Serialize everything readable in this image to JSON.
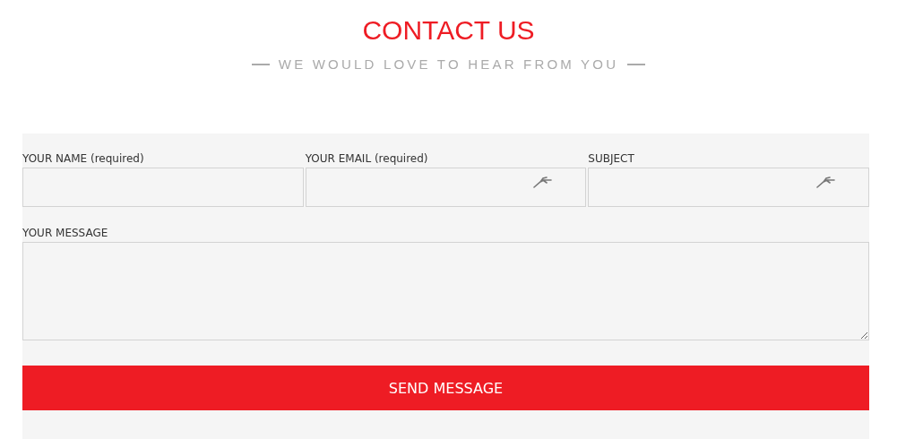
{
  "header": {
    "title": "CONTACT US",
    "subtitle": "WE WOULD LOVE TO HEAR FROM YOU"
  },
  "fields": [
    {
      "label": "YOUR NAME (required)",
      "kind": "text",
      "autofill_icon": false
    },
    {
      "label": "YOUR EMAIL (required)",
      "kind": "text",
      "autofill_icon": true
    },
    {
      "label": "SUBJECT",
      "kind": "text",
      "autofill_icon": true
    },
    {
      "label": "YOUR MESSAGE",
      "kind": "textarea"
    }
  ],
  "submit": {
    "label": "SEND MESSAGE"
  }
}
